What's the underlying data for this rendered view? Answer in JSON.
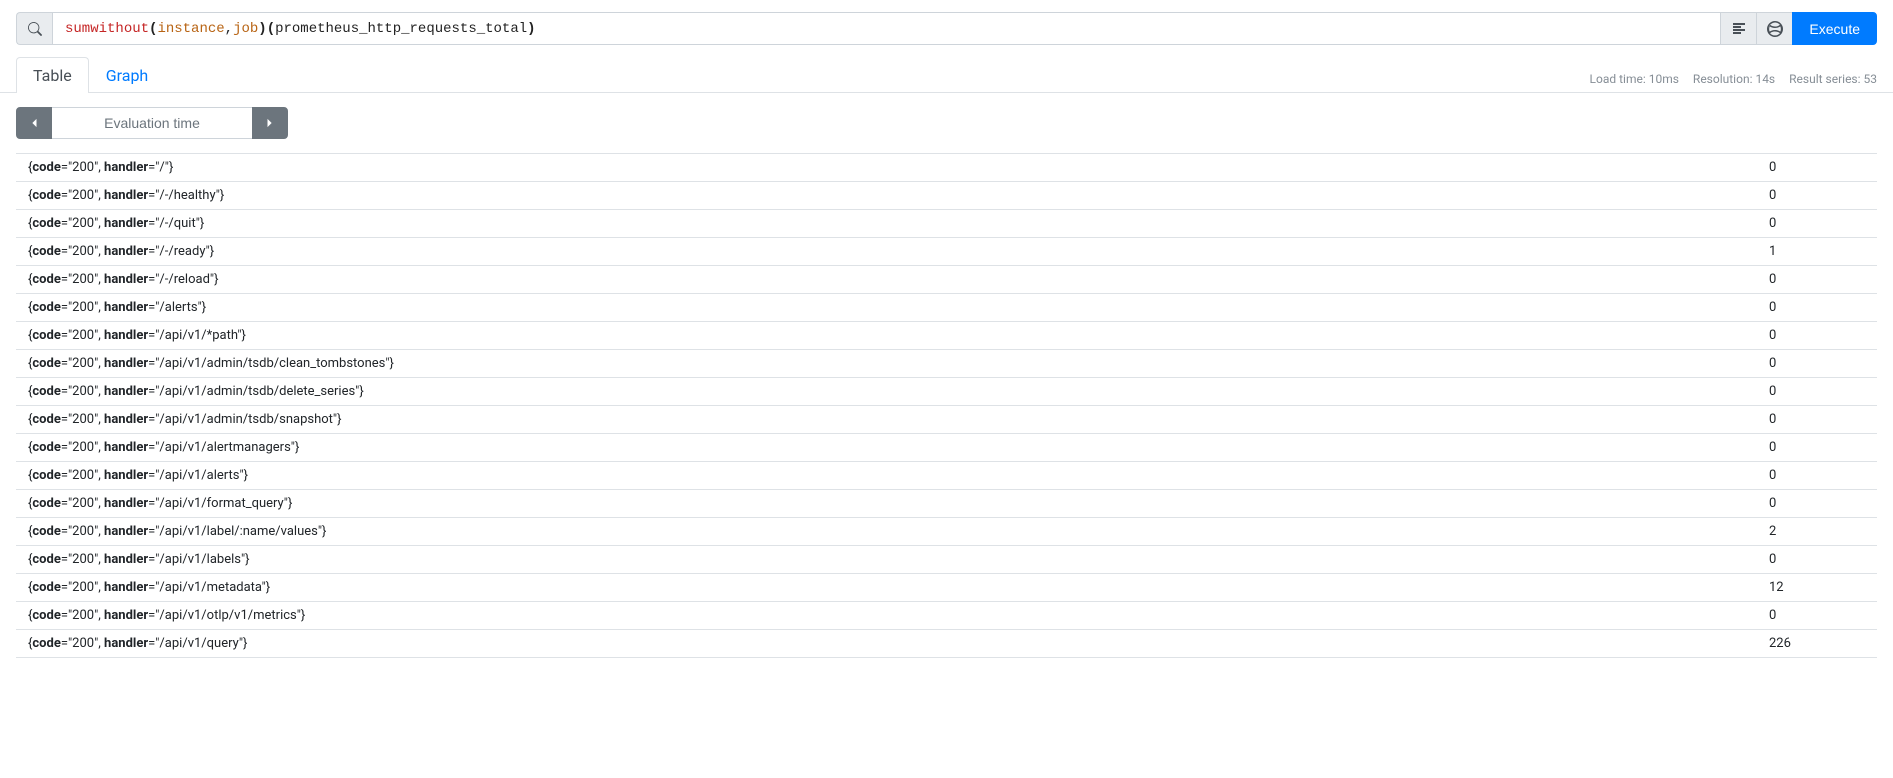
{
  "query": {
    "tokens": [
      {
        "t": "sum",
        "cls": "tok-keyword"
      },
      {
        "t": " ",
        "cls": ""
      },
      {
        "t": "without",
        "cls": "tok-keyword"
      },
      {
        "t": " ",
        "cls": ""
      },
      {
        "t": "(",
        "cls": "tok-paren"
      },
      {
        "t": "instance",
        "cls": "tok-label"
      },
      {
        "t": ",",
        "cls": ""
      },
      {
        "t": "job",
        "cls": "tok-label"
      },
      {
        "t": ")",
        "cls": "tok-paren"
      },
      {
        "t": " ",
        "cls": ""
      },
      {
        "t": "(",
        "cls": "tok-paren"
      },
      {
        "t": "prometheus_http_requests_total",
        "cls": "tok-metric"
      },
      {
        "t": ")",
        "cls": "tok-paren"
      }
    ]
  },
  "buttons": {
    "execute": "Execute"
  },
  "tabs": {
    "table": "Table",
    "graph": "Graph"
  },
  "meta": {
    "load_time": "Load time: 10ms",
    "resolution": "Resolution: 14s",
    "result_series": "Result series: 53"
  },
  "eval": {
    "placeholder": "Evaluation time"
  },
  "label_names": {
    "code": "code",
    "handler": "handler"
  },
  "results": [
    {
      "code": "200",
      "handler": "/",
      "value": "0"
    },
    {
      "code": "200",
      "handler": "/-/healthy",
      "value": "0"
    },
    {
      "code": "200",
      "handler": "/-/quit",
      "value": "0"
    },
    {
      "code": "200",
      "handler": "/-/ready",
      "value": "1"
    },
    {
      "code": "200",
      "handler": "/-/reload",
      "value": "0"
    },
    {
      "code": "200",
      "handler": "/alerts",
      "value": "0"
    },
    {
      "code": "200",
      "handler": "/api/v1/*path",
      "value": "0"
    },
    {
      "code": "200",
      "handler": "/api/v1/admin/tsdb/clean_tombstones",
      "value": "0"
    },
    {
      "code": "200",
      "handler": "/api/v1/admin/tsdb/delete_series",
      "value": "0"
    },
    {
      "code": "200",
      "handler": "/api/v1/admin/tsdb/snapshot",
      "value": "0"
    },
    {
      "code": "200",
      "handler": "/api/v1/alertmanagers",
      "value": "0"
    },
    {
      "code": "200",
      "handler": "/api/v1/alerts",
      "value": "0"
    },
    {
      "code": "200",
      "handler": "/api/v1/format_query",
      "value": "0"
    },
    {
      "code": "200",
      "handler": "/api/v1/label/:name/values",
      "value": "2"
    },
    {
      "code": "200",
      "handler": "/api/v1/labels",
      "value": "0"
    },
    {
      "code": "200",
      "handler": "/api/v1/metadata",
      "value": "12"
    },
    {
      "code": "200",
      "handler": "/api/v1/otlp/v1/metrics",
      "value": "0"
    },
    {
      "code": "200",
      "handler": "/api/v1/query",
      "value": "226"
    }
  ]
}
